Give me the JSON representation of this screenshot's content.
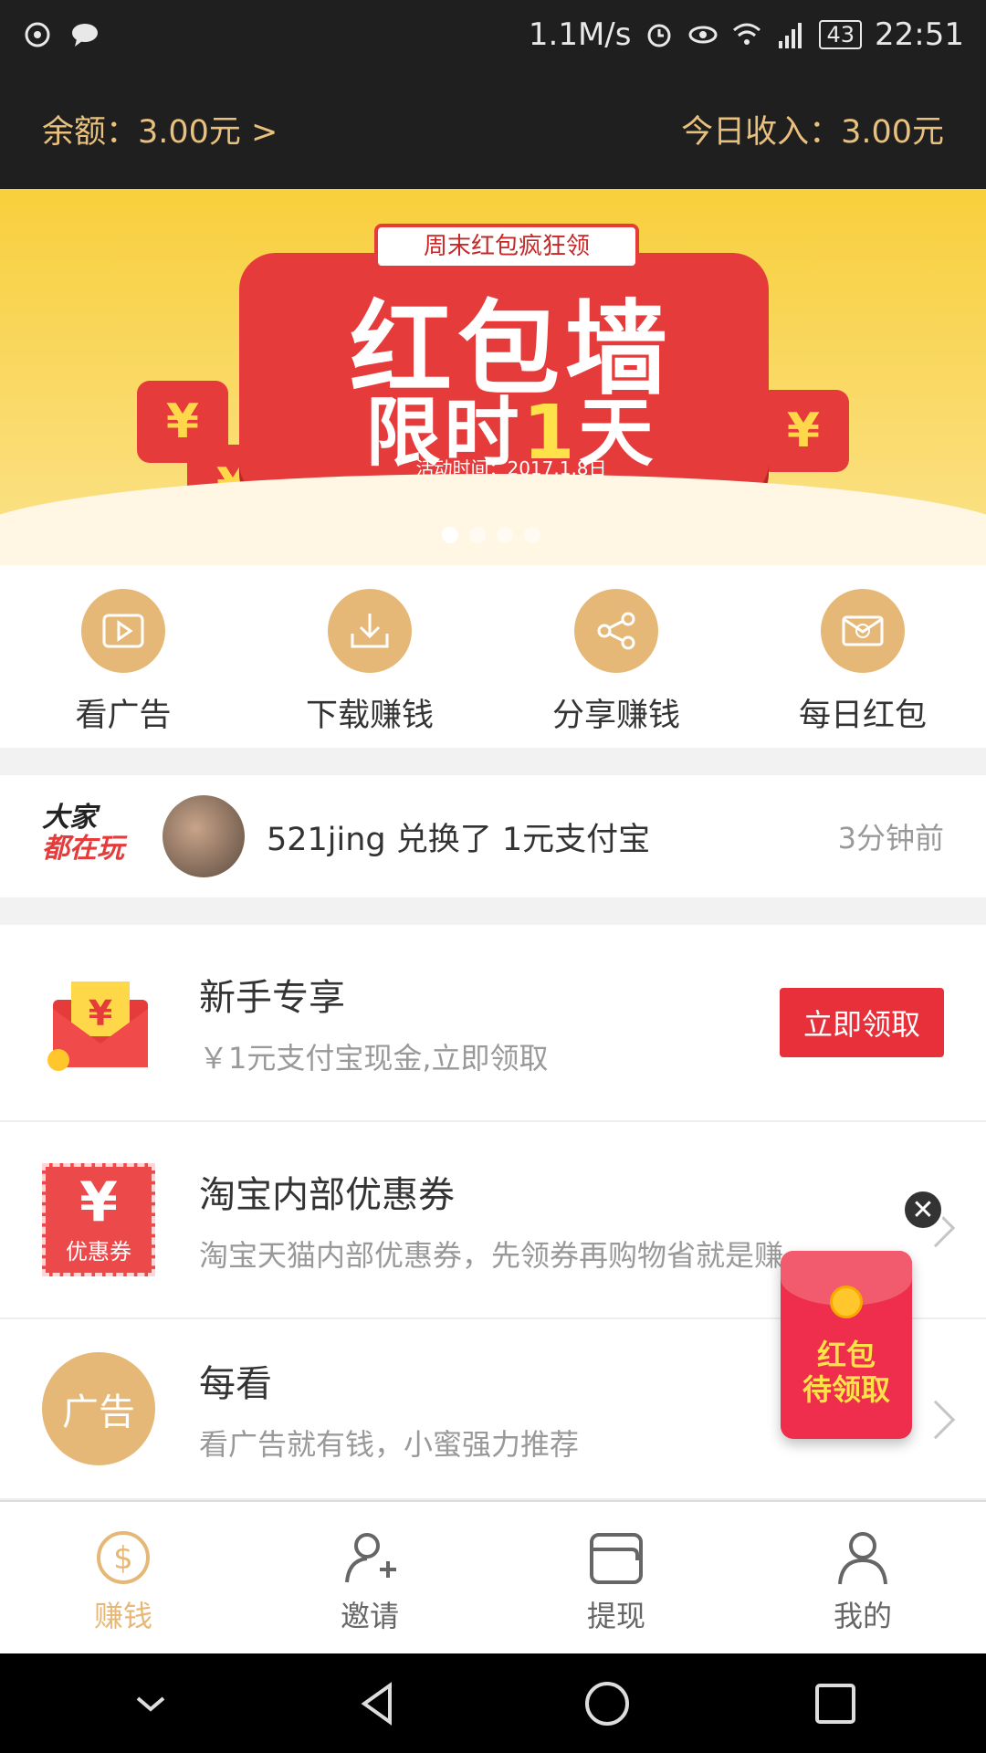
{
  "status_bar": {
    "speed": "1.1M/s",
    "network": "4G",
    "battery": "43",
    "time": "22:51"
  },
  "balance": {
    "left": "余额：3.00元 >",
    "right": "今日收入：3.00元"
  },
  "banner": {
    "ribbon": "周末红包疯狂领",
    "title_line1": "红包墙",
    "title_line2_a": "限时",
    "title_line2_b": "1",
    "title_line2_c": "天",
    "date": "活动时间：2017.1.8日",
    "coin_symbol": "¥",
    "dots": 4,
    "active_dot": 0
  },
  "actions": [
    {
      "label": "看广告",
      "icon": "play-icon"
    },
    {
      "label": "下载赚钱",
      "icon": "download-icon"
    },
    {
      "label": "分享赚钱",
      "icon": "share-icon"
    },
    {
      "label": "每日红包",
      "icon": "envelope-icon"
    }
  ],
  "ticker": {
    "logo_line1": "大家",
    "logo_line2": "都在玩",
    "text": "521jing 兑换了 1元支付宝",
    "time": "3分钟前"
  },
  "list": [
    {
      "title": "新手专享",
      "subtitle": "￥1元支付宝现金,立即领取",
      "button": "立即领取"
    },
    {
      "title": "淘宝内部优惠券",
      "subtitle": "淘宝天猫内部优惠券，先领券再购物省就是赚",
      "coupon_symbol": "¥",
      "coupon_caption": "优惠券"
    },
    {
      "title": "每看",
      "subtitle": "看广告就有钱，小蜜强力推荐",
      "thumb_label": "广告"
    }
  ],
  "float_packet": {
    "line1": "红包",
    "line2": "待领取"
  },
  "tabs": [
    {
      "label": "赚钱",
      "active": true
    },
    {
      "label": "邀请",
      "active": false
    },
    {
      "label": "提现",
      "active": false
    },
    {
      "label": "我的",
      "active": false
    }
  ],
  "colors": {
    "gold": "#e6b877",
    "red": "#e8303a",
    "dark": "#1f1f1f"
  }
}
